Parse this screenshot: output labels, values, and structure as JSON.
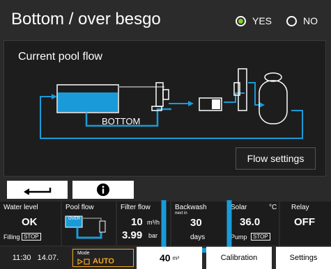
{
  "header": {
    "title": "Bottom / over besgo",
    "options": [
      {
        "label": "YES",
        "selected": true
      },
      {
        "label": "NO",
        "selected": false
      }
    ]
  },
  "panel": {
    "title": "Current pool flow",
    "bottom_label": "BOTTOM",
    "flow_settings_label": "Flow settings"
  },
  "tiles": {
    "water_level": {
      "label": "Water level",
      "value": "OK",
      "status_label": "Filling",
      "status": "STOP"
    },
    "pool_flow": {
      "label": "Pool flow",
      "mini_label": "OVER"
    },
    "filter_flow": {
      "label": "Filter flow",
      "value1": "10",
      "unit1": "m³/h",
      "value2": "3.99",
      "unit2": "bar"
    },
    "backwash": {
      "label": "Backwash",
      "sublabel": "next in",
      "value": "30",
      "unit": "days"
    },
    "solar": {
      "label": "Solar",
      "unit": "°C",
      "value": "36.0",
      "status_label": "Pump",
      "status": "STOP"
    },
    "relay": {
      "label": "Relay",
      "value": "OFF"
    }
  },
  "bottom_bar": {
    "time": "11:30",
    "date": "14.07.",
    "mode_label": "Mode",
    "mode_value": "AUTO",
    "volume_value": "40",
    "volume_unit": "m³",
    "calibration_label": "Calibration",
    "settings_label": "Settings"
  },
  "colors": {
    "accent_blue": "#1a9bd7",
    "yes_green": "#7ed321",
    "mode_yellow": "#f5a623"
  }
}
